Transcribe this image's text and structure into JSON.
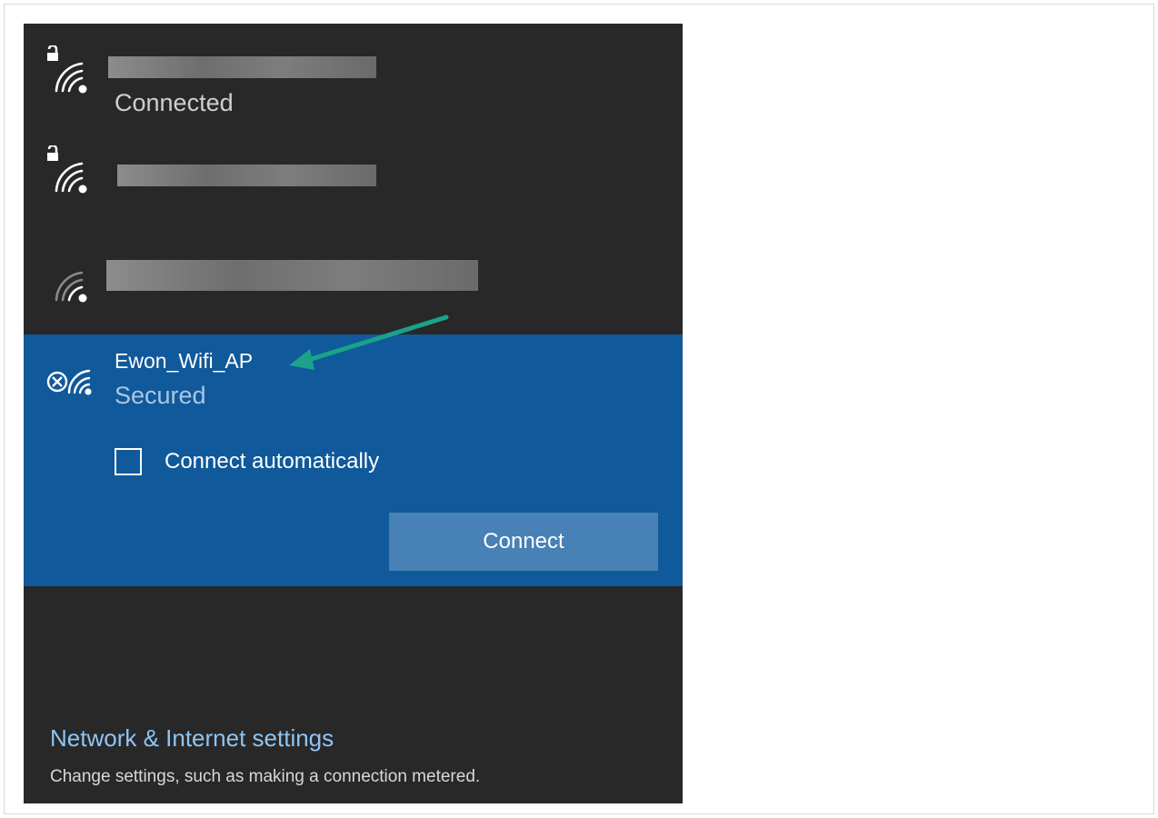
{
  "networks": [
    {
      "icon": "wifi-secured-icon",
      "name_redacted": true,
      "status": "Connected"
    },
    {
      "icon": "wifi-secured-icon",
      "name_redacted": true,
      "status": ""
    },
    {
      "icon": "wifi-open-icon",
      "name_redacted": true,
      "status": ""
    }
  ],
  "selected_network": {
    "icon": "wifi-unavailable-icon",
    "name": "Ewon_Wifi_AP",
    "status": "Secured",
    "connect_automatically_label": "Connect automatically",
    "connect_automatically_checked": false,
    "connect_button_label": "Connect"
  },
  "settings": {
    "link_label": "Network & Internet settings",
    "description": "Change settings, such as making a connection metered."
  },
  "colors": {
    "flyout_background": "#282828",
    "selected_background": "#10599a",
    "connect_button": "#4781b5",
    "link": "#8ec5f5",
    "annotation_arrow": "#1aa28a"
  }
}
